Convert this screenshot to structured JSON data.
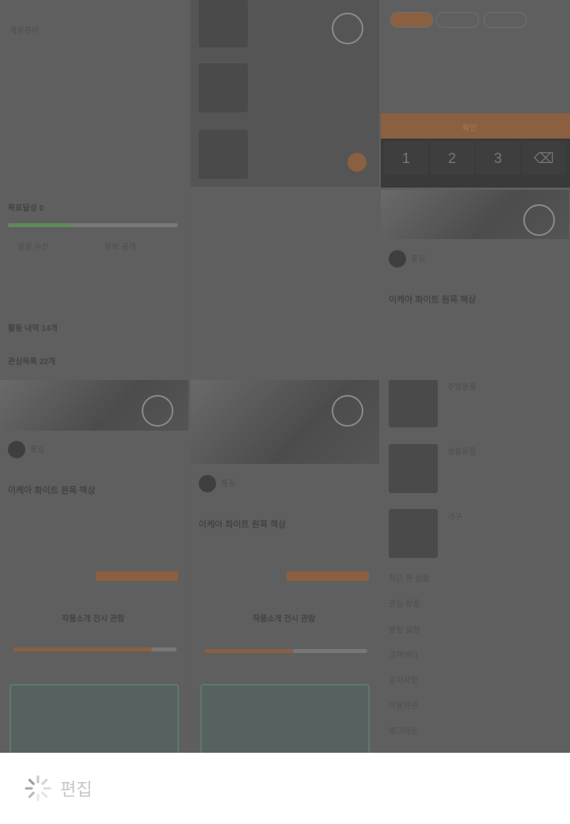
{
  "bottom_bar": {
    "edit_label": "편집"
  },
  "background": {
    "col1": {
      "menu_row_1": "계정관리",
      "progress_label": "목표달성 0",
      "progress_value": 0.38,
      "option_a": "알림 수신",
      "option_b": "정보 공개",
      "row_1": "활동 내역 14개",
      "row_2": "관심목록 22개",
      "post_title": "이케아 화이트 원목 책상",
      "author": "홍길",
      "card_title": "작품소개 전시 관람",
      "card_progress": 0.85
    },
    "col2": {
      "post_title": "이케아 화이트 원목 책상",
      "author": "홍길",
      "card_title": "작품소개 전시 관람",
      "card_progress": 0.55
    },
    "col3": {
      "confirm_button": "확인",
      "keys": [
        "1",
        "2",
        "3"
      ],
      "post_title": "이케아 화이트 원목 책상",
      "author": "홍길",
      "list_items": [
        "주방용품",
        "생활용품",
        "가구"
      ],
      "menu_rows": [
        "최근 본 상품",
        "관심 상품",
        "알림 설정",
        "고객센터",
        "공지사항",
        "이용약관",
        "로그아웃"
      ]
    }
  },
  "colors": {
    "overlay": "#5e5e5e",
    "accent": "#8a6040",
    "map_teal": "#5e7772",
    "progress_green": "#5f8a5a"
  }
}
